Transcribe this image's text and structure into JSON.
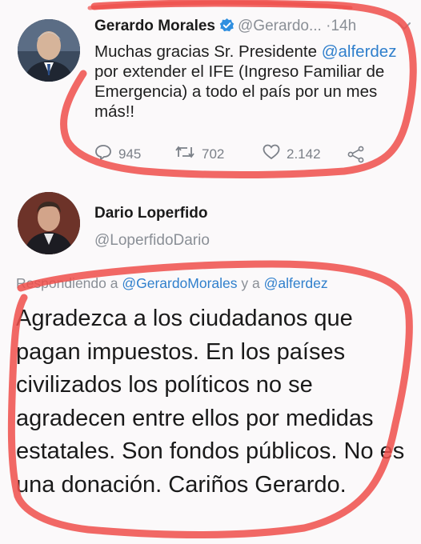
{
  "tweet1": {
    "display_name": "Gerardo Morales",
    "handle": "@Gerardo...",
    "separator": "·",
    "time": "14h",
    "text_before": "Muchas gracias Sr. Presidente ",
    "mention": "@alferdez",
    "text_after": " por extender el IFE (Ingreso Familiar de Emergencia) a todo el país por un mes más!!",
    "replies": "945",
    "retweets": "702",
    "likes": "2.142"
  },
  "tweet2": {
    "display_name": "Dario Loperfido",
    "handle": "@LoperfidoDario",
    "replying_prefix": "Respondiendo a ",
    "replying_mention1": "@GerardoMorales",
    "replying_joiner": " y a ",
    "replying_mention2": "@alferdez",
    "text": "Agradezca a los ciudadanos que pagan impuestos. En los países civilizados los políticos no se agradecen entre ellos por medidas estatales. Son fondos públicos. No es una donación. Cariños Gerardo."
  },
  "colors": {
    "mention_blue": "#2f7fcc",
    "annotation_red": "#ee4f4a",
    "muted_gray": "#8a8f96"
  },
  "icons": [
    "verified-badge-icon",
    "chevron-down-icon",
    "reply-icon",
    "retweet-icon",
    "like-heart-icon",
    "share-icon"
  ]
}
